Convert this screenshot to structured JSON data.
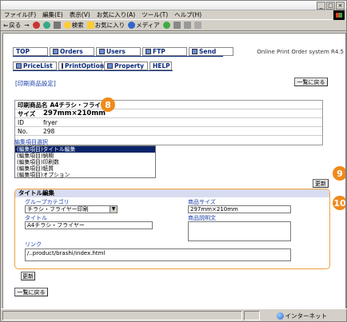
{
  "browser": {
    "menu": [
      "ファイル(F)",
      "編集(E)",
      "表示(V)",
      "お気に入り(A)",
      "ツール(T)",
      "ヘルプ(H)"
    ],
    "toolbar": [
      "戻る",
      "検索",
      "お気に入り",
      "メディア"
    ],
    "status_zone": "インターネット"
  },
  "tabs_primary": [
    {
      "label": "TOP"
    },
    {
      "label": "Orders"
    },
    {
      "label": "Users"
    },
    {
      "label": "FTP"
    },
    {
      "label": "Send"
    }
  ],
  "tabs_secondary": [
    {
      "label": "PriceList"
    },
    {
      "label": "PrintOption"
    },
    {
      "label": "Property"
    },
    {
      "label": "HELP"
    }
  ],
  "system_name": "Online Print Order system R4.5",
  "page_title": "[印刷商品設定]",
  "back_to_list_label": "一覧に戻る",
  "product": {
    "name_label": "印刷商品名",
    "name_value": "A4チラシ・フライヤー",
    "size_label": "サイズ",
    "size_value": "297mm×210mm",
    "id_label": "ID",
    "id_value": "fryer",
    "no_label": "No.",
    "no_value": "298"
  },
  "edit_select": {
    "label": "編集項目選択",
    "items": [
      "(編集項目)タイトル編集",
      "(編集項目)納期",
      "(編集項目)印刷数",
      "(編集項目)紙質",
      "(編集項目)オプション"
    ],
    "selected_index": 0
  },
  "update_label": "更新",
  "callouts": {
    "c8": "8",
    "c9": "9",
    "c10": "10"
  },
  "title_edit": {
    "header": "タイトル編集",
    "group_label": "グループカテゴリ",
    "group_value": "チラシ・フライヤー印刷",
    "title_label": "タイトル",
    "title_value": "A4チラシ・フライヤー",
    "size_label": "商品サイズ",
    "size_value": "297mm×210mm",
    "desc_label": "商品説明文",
    "link_label": "リンク",
    "link_value": "/..product/brashi/index.html"
  },
  "colors": {
    "accent": "#f08a1a",
    "link": "#1b3ea8",
    "tab_text": "#0a2a7a"
  }
}
